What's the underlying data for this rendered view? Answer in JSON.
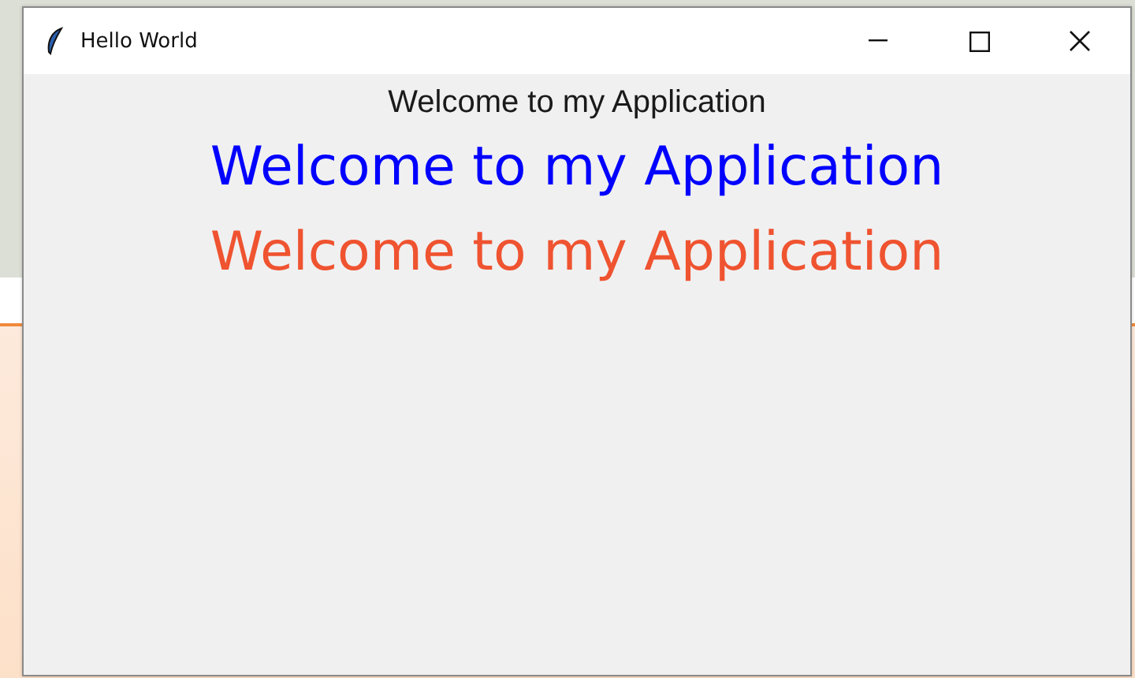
{
  "window": {
    "title": "Hello World"
  },
  "labels": [
    {
      "text": "Welcome to my Application",
      "kind": "small",
      "color": "#1a1a1a"
    },
    {
      "text": "Welcome to my Application",
      "kind": "large",
      "color": "#0000ff"
    },
    {
      "text": "Welcome to my Application",
      "kind": "large",
      "color": "#ef5330"
    }
  ]
}
